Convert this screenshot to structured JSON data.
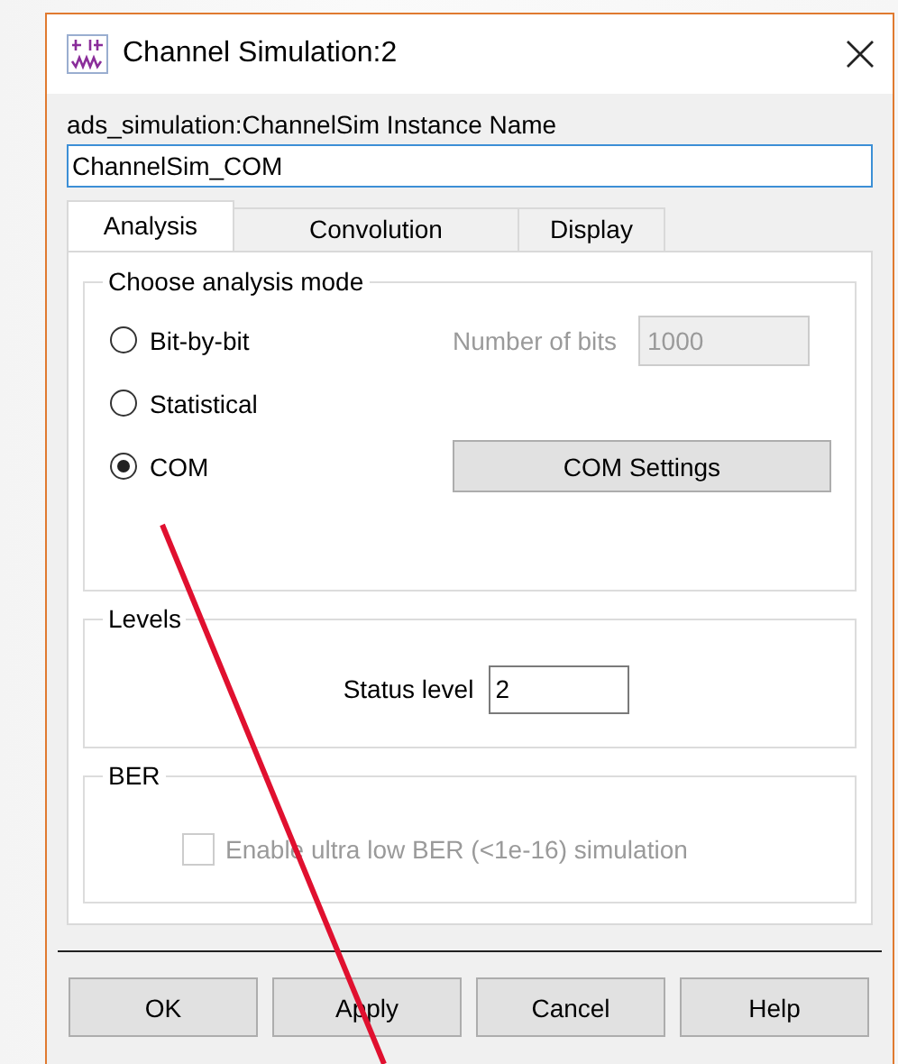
{
  "window": {
    "title": "Channel Simulation:2"
  },
  "instance": {
    "label": "ads_simulation:ChannelSim Instance Name",
    "value": "ChannelSim_COM"
  },
  "tabs": [
    {
      "label": "Analysis",
      "selected": true
    },
    {
      "label": "Convolution",
      "selected": false
    },
    {
      "label": "Display",
      "selected": false
    }
  ],
  "analysis_mode": {
    "title": "Choose analysis mode",
    "modes": [
      {
        "label": "Bit-by-bit",
        "selected": false
      },
      {
        "label": "Statistical",
        "selected": false
      },
      {
        "label": "COM",
        "selected": true
      }
    ],
    "number_of_bits": {
      "label": "Number of bits",
      "value": "1000",
      "disabled": true
    },
    "settings_button": "COM Settings"
  },
  "levels": {
    "title": "Levels",
    "status_label": "Status level",
    "status_value": "2"
  },
  "ber": {
    "title": "BER",
    "checkbox": {
      "label": "Enable ultra low BER (<1e-16) simulation",
      "checked": false,
      "disabled": true
    }
  },
  "buttons": [
    "OK",
    "Apply",
    "Cancel",
    "Help"
  ]
}
